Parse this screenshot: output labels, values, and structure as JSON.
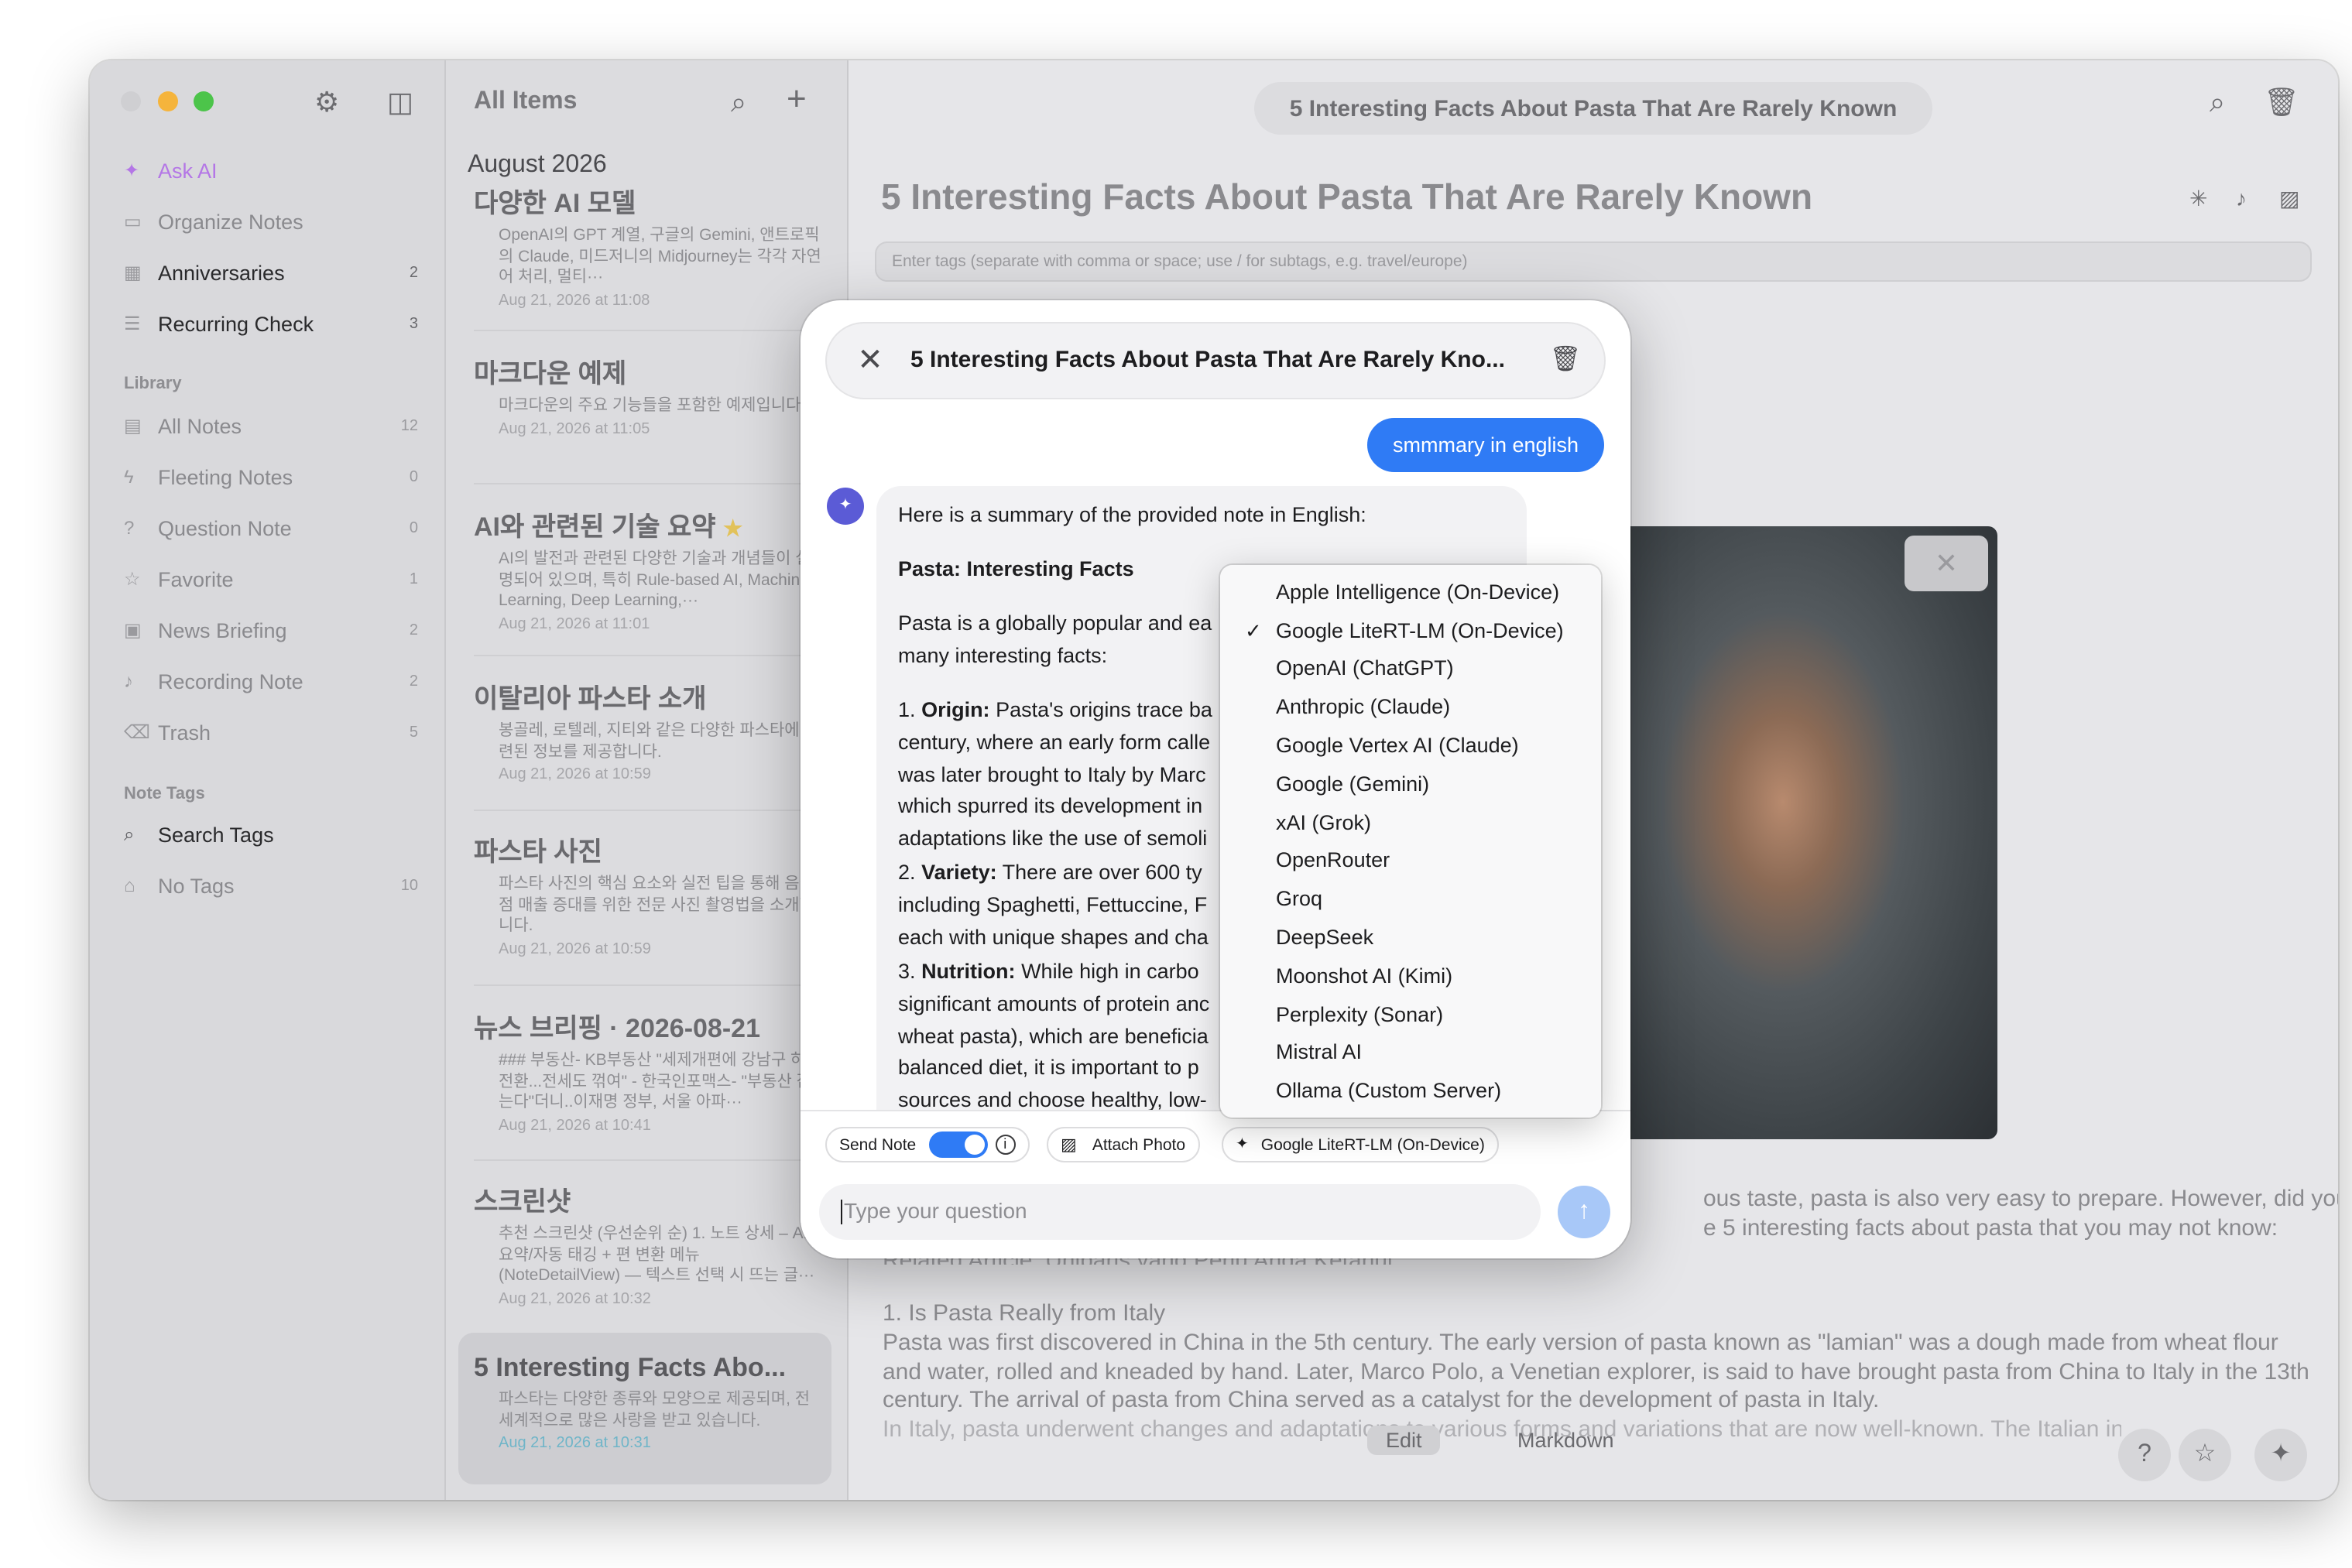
{
  "sidebar": {
    "items": [
      {
        "label": "Ask AI",
        "icon": "sparkle-icon",
        "count": ""
      },
      {
        "label": "Organize Notes",
        "icon": "folder-icon",
        "count": ""
      },
      {
        "label": "Anniversaries",
        "icon": "calendar-icon",
        "count": "2"
      },
      {
        "label": "Recurring Check",
        "icon": "checklist-icon",
        "count": "3"
      }
    ],
    "library_heading": "Library",
    "library": [
      {
        "label": "All Notes",
        "icon": "note-icon",
        "count": "12"
      },
      {
        "label": "Fleeting Notes",
        "icon": "bolt-icon",
        "count": "0"
      },
      {
        "label": "Question Note",
        "icon": "question-icon",
        "count": "0"
      },
      {
        "label": "Favorite",
        "icon": "star-icon",
        "count": "1"
      },
      {
        "label": "News Briefing",
        "icon": "newspaper-icon",
        "count": "2"
      },
      {
        "label": "Recording Note",
        "icon": "mic-icon",
        "count": "2"
      },
      {
        "label": "Trash",
        "icon": "trash-icon",
        "count": "5"
      }
    ],
    "tags_heading": "Note Tags",
    "tags": [
      {
        "label": "Search Tags",
        "icon": "search-icon",
        "count": ""
      },
      {
        "label": "No Tags",
        "icon": "tag-icon",
        "count": "10"
      }
    ]
  },
  "list": {
    "title": "All Items",
    "month": "August 2026",
    "notes": [
      {
        "title": "다양한 AI 모델",
        "preview": "OpenAI의 GPT 계열, 구글의 Gemini, 앤트로픽의 Claude, 미드저니의 Midjourney는 각각 자연어 처리, 멀티···",
        "date": "Aug 21, 2026 at 11:08"
      },
      {
        "title": "마크다운 예제",
        "preview": "마크다운의 주요 기능들을 포함한 예제입니다.",
        "date": "Aug 21, 2026 at 11:05"
      },
      {
        "title": "AI와 관련된 기술 요약",
        "star": "★",
        "preview": "AI의 발전과 관련된 다양한 기술과 개념들이 설명되어 있으며, 특히 Rule-based AI, Machine Learning, Deep Learning,···",
        "date": "Aug 21, 2026 at 11:01"
      },
      {
        "title": "이탈리아 파스타 소개",
        "preview": "봉골레, 로텔레, 지티와 같은 다양한 파스타에 관련된 정보를 제공합니다.",
        "date": "Aug 21, 2026 at 10:59"
      },
      {
        "title": "파스타 사진",
        "preview": "파스타 사진의 핵심 요소와 실전 팁을 통해 음식점 매출 증대를 위한 전문 사진 촬영법을 소개합니다.",
        "date": "Aug 21, 2026 at 10:59"
      },
      {
        "title": "뉴스 브리핑 · 2026-08-21",
        "preview": "### 부동산- KB부동산 \"세제개편에 강남구 하락 전환...전세도 꺾여\" - 한국인포맥스- \"부동산 잡는다\"더니..이재명 정부, 서울 아파···",
        "date": "Aug 21, 2026 at 10:41"
      },
      {
        "title": "스크린샷",
        "preview": "추천 스크린샷 (우선순위 순) 1. 노트 상세 – AI 요약/자동 태깅 + 편 변환 메뉴 (NoteDetailView) — 텍스트 선택 시 뜨는 글···",
        "date": "Aug 21, 2026 at 10:32"
      },
      {
        "title": "5 Interesting Facts Abo...",
        "preview": "파스타는 다양한 종류와 모양으로 제공되며, 전 세계적으로 많은 사랑을 받고 있습니다.",
        "date": "Aug 21, 2026 at 10:31"
      }
    ]
  },
  "main": {
    "toolbar_title": "5 Interesting Facts About Pasta That Are Rarely Known",
    "heading": "5 Interesting Facts About Pasta That Are Rarely Known",
    "tags_placeholder": "Enter tags (separate with comma or space; use / for subtags, e.g. travel/europe)",
    "body_line1": "ous taste, pasta is also very easy to prepare. However, did you",
    "body_line2": "e 5 interesting facts about pasta that you may not know:",
    "related": "Related Article: Uniparis yang Perlu Anda Ketahui",
    "section1": "1. Is Pasta Really from Italy",
    "para1": [
      "Pasta was first discovered in China in the 5th century. The early version of pasta known as \"lamian\" was a dough made from wheat flour",
      "and water, rolled and kneaded by hand. Later, Marco Polo, a Venetian explorer, is said to have brought pasta from China to Italy in the 13th",
      "century. The arrival of pasta from China served as a catalyst for the development of pasta in Italy.",
      "In Italy, pasta underwent changes and adaptations to various forms and variations that are now well-known. The Italian influence on pasta"
    ],
    "edit_label": "Edit",
    "markdown_label": "Markdown"
  },
  "dialog": {
    "title": "5 Interesting Facts About Pasta That Are Rarely Kno...",
    "user_message": "smmmary in english",
    "ai_lines": [
      {
        "text": "Here is a summary of the provided note in English:"
      },
      {
        "text": "Pasta: Interesting Facts",
        "bold": true
      },
      {
        "text": "Pasta is a globally popular and ea"
      },
      {
        "text": "many interesting facts:"
      },
      {
        "num": "1.",
        "label": "Origin:",
        "text": "Pasta's origins trace ba"
      },
      {
        "text": "century, where an early form calle"
      },
      {
        "text": "was later brought to Italy by Marc"
      },
      {
        "text": "which spurred its development in"
      },
      {
        "text": "adaptations like the use of semoli"
      },
      {
        "num": "2.",
        "label": "Variety:",
        "text": "There are over 600 ty"
      },
      {
        "text": "including Spaghetti, Fettuccine, F"
      },
      {
        "text": "each with unique shapes and cha"
      },
      {
        "num": "3.",
        "label": "Nutrition:",
        "text": "While high in carbo"
      },
      {
        "text": "significant amounts of protein anc"
      },
      {
        "text": "wheat pasta), which are beneficia"
      },
      {
        "text": "balanced diet, it is important to p"
      },
      {
        "text": "sources and choose healthy, low-"
      }
    ],
    "send_note_label": "Send Note",
    "attach_photo_label": "Attach Photo",
    "model_chip_label": "Google LiteRT-LM (On-Device)",
    "input_placeholder": "Type your question"
  },
  "model_menu": {
    "selected": "Google LiteRT-LM (On-Device)",
    "options": [
      "Apple Intelligence (On-Device)",
      "Google LiteRT-LM (On-Device)",
      "OpenAI (ChatGPT)",
      "Anthropic (Claude)",
      "Google Vertex AI (Claude)",
      "Google (Gemini)",
      "xAI (Grok)",
      "OpenRouter",
      "Groq",
      "DeepSeek",
      "Moonshot AI (Kimi)",
      "Perplexity (Sonar)",
      "Mistral AI",
      "Ollama (Custom Server)"
    ]
  },
  "colors": {
    "accent": "#2f7bf5",
    "ask_ai": "#b476e6",
    "ai_avatar": "#5b5bd6"
  }
}
